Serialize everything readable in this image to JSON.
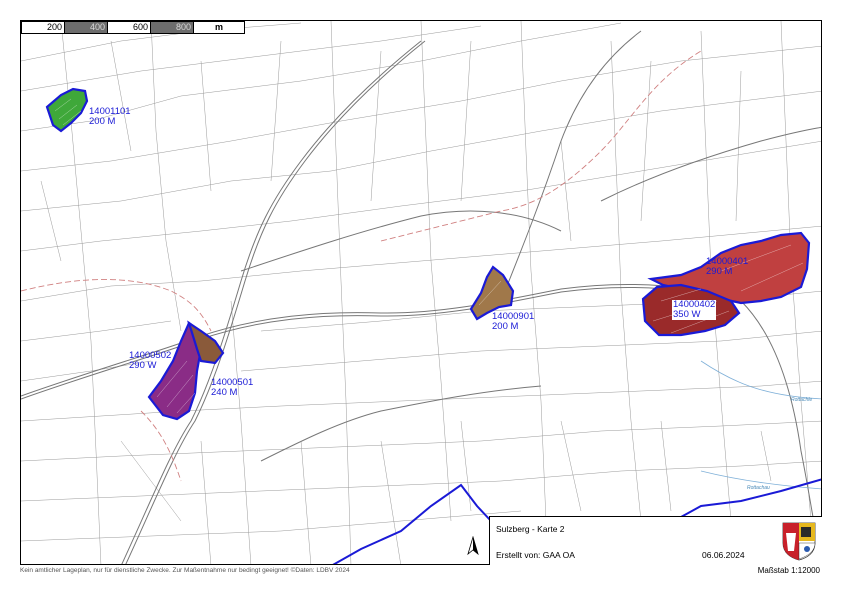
{
  "scalebar": {
    "ticks": [
      "200",
      "400",
      "600",
      "800"
    ],
    "unit": "m"
  },
  "zones": [
    {
      "id": "14001101",
      "note": "200 M",
      "fill": "#3fa83a"
    },
    {
      "id": "14000901",
      "note": "200 M",
      "fill": "#a0784a"
    },
    {
      "id": "14000502",
      "note": "290 W",
      "fill": "#8a2c86"
    },
    {
      "id": "14000501",
      "note": "240 M",
      "fill": "#8a5a3a"
    },
    {
      "id": "14000401",
      "note": "290 M",
      "fill": "#c04040"
    },
    {
      "id": "14000402",
      "note": "350 W",
      "fill": "#9a2a2a"
    }
  ],
  "colors": {
    "boundary": "#1a1ad6",
    "parcel_line": "#8a8a8a",
    "road": "#6f6f6f",
    "admin_dash": "#d08080",
    "river": "#7fb0d8"
  },
  "title_box": {
    "title": "Sulzberg - Karte 2",
    "created_by": "Erstellt von: GAA OA",
    "date": "06.06.2024",
    "north_icon": "north-arrow-icon",
    "crest_icon": "coat-of-arms-icon"
  },
  "footer": {
    "disclaimer": "Kein amtlicher Lageplan, nur für dienstliche Zwecke. Zur Maßentnahme nur bedingt geeignet! ©Daten: LDBV 2024",
    "scale": "Maßstab 1:12000"
  },
  "place_labels": [
    "Rottachle",
    "Rottachau"
  ]
}
